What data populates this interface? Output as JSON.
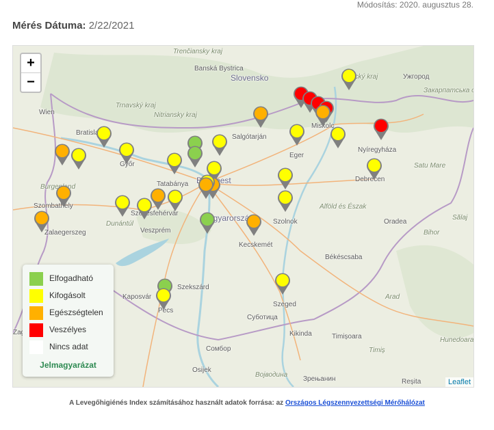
{
  "header": {
    "modified": "Módosítás: 2020. augusztus 28.",
    "date_label": "Mérés Dátuma:",
    "date_value": "2/22/2021"
  },
  "map": {
    "zoom_in": "+",
    "zoom_out": "−",
    "attribution": "Leaflet",
    "place_labels": [
      "Trenčiansky kraj",
      "Banská Bystrica",
      "Slovensko",
      "Košický kraj",
      "Ужгород",
      "Закарпатська область",
      "Wien",
      "Trnavský kraj",
      "Nitriansky kraj",
      "Bratislava",
      "Győr",
      "Salgótarján",
      "Miskolc",
      "Nyíregyháza",
      "Eger",
      "Tatabánya",
      "Budapest",
      "Burgenland",
      "Szombathely",
      "Székesfehérvár",
      "Veszprém",
      "Magyarország",
      "Szolnok",
      "Debrecen",
      "Satu Mare",
      "Alföld és Észak",
      "Oradea",
      "Sălaj",
      "Bihor",
      "Zalaegerszeg",
      "Dunántúl",
      "Kecskemét",
      "Békéscsaba",
      "Arad",
      "Szekszárd",
      "Kaposvár",
      "Pécs",
      "Szeged",
      "Суботица",
      "Kikinda",
      "Timișoara",
      "Hunedoara",
      "Сомбор",
      "Osijek",
      "Timiș",
      "Војводина",
      "Зрењанин",
      "Reșita",
      "Zagreb"
    ]
  },
  "legend": {
    "title": "Jelmagyarázat",
    "items": [
      {
        "label": "Elfogadható",
        "color": "#8bd04e"
      },
      {
        "label": "Kifogásolt",
        "color": "#ffff00"
      },
      {
        "label": "Egészségtelen",
        "color": "#ffb000"
      },
      {
        "label": "Veszélyes",
        "color": "#ff0000"
      },
      {
        "label": "Nincs adat",
        "color": "#ffffff"
      }
    ]
  },
  "footer": {
    "text": "A Levegőhigiénés Index számításához használt adatok forrása: az",
    "link": "Országos Légszennyezettségi Mérőhálózat"
  }
}
